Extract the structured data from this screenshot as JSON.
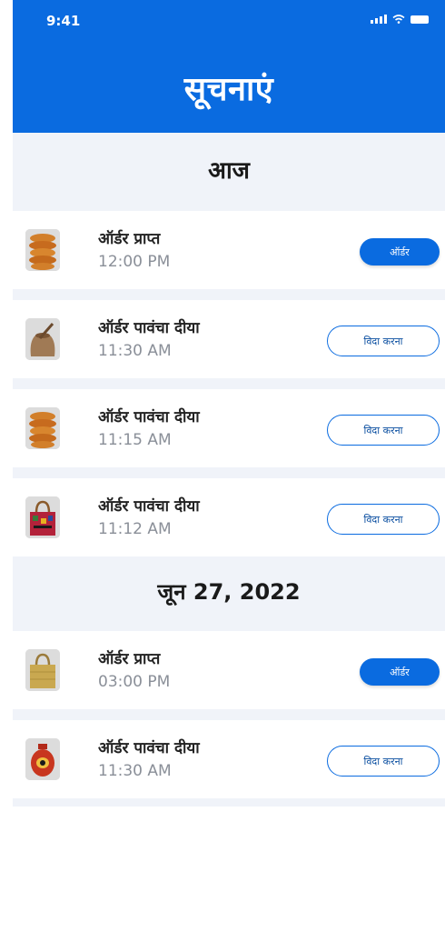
{
  "status": {
    "time": "9:41"
  },
  "header": {
    "title": "सूचनाएं"
  },
  "sections": [
    {
      "label": "आज"
    },
    {
      "label": "जून 27, 2022"
    }
  ],
  "notifications": [
    {
      "title": "ऑर्डर प्राप्त",
      "time": "12:00 PM",
      "action": "ऑर्डर",
      "style": "filled",
      "thumb": "snacks-stack-icon"
    },
    {
      "title": "ऑर्डर पावंचा दीया",
      "time": "11:30 AM",
      "action": "विदा करना",
      "style": "outline",
      "thumb": "spice-sack-icon"
    },
    {
      "title": "ऑर्डर पावंचा दीया",
      "time": "11:15 AM",
      "action": "विदा करना",
      "style": "outline",
      "thumb": "snacks-stack-icon"
    },
    {
      "title": "ऑर्डर पावंचा दीया",
      "time": "11:12 AM",
      "action": "विदा करना",
      "style": "outline",
      "thumb": "embroidered-bag-icon"
    },
    {
      "title": "ऑर्डर प्राप्त",
      "time": "03:00 PM",
      "action": "ऑर्डर",
      "style": "filled",
      "thumb": "jute-bag-icon"
    },
    {
      "title": "ऑर्डर पावंचा दीया",
      "time": "11:30 AM",
      "action": "विदा करना",
      "style": "outline",
      "thumb": "painted-pot-icon"
    }
  ],
  "colors": {
    "primary": "#0a6be0",
    "background": "#f0f3f9"
  }
}
